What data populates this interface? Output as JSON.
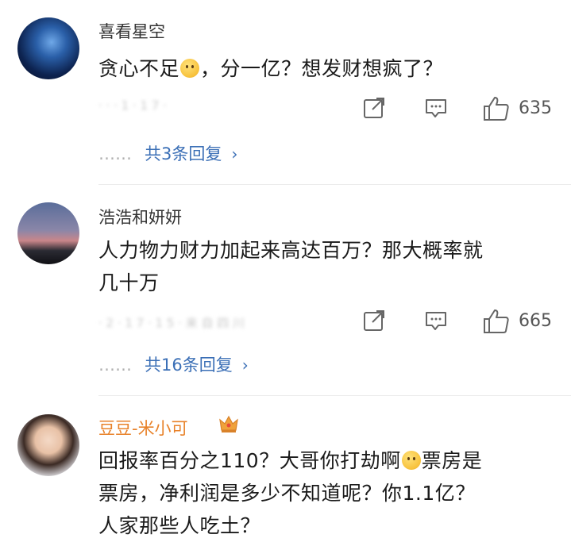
{
  "comments": [
    {
      "username": "喜看星空",
      "text_before_emoji": "贪心不足",
      "text_after_emoji": "，分一亿？想发财想疯了？",
      "meta": "· · · 1 · 1 7 ·",
      "likes": "635",
      "replies_prefix": "……",
      "replies_link": "共3条回复",
      "chevron": "›"
    },
    {
      "username": "浩浩和妍妍",
      "line1": "人力物力财力加起来高达百万？那大概率就",
      "line2": "几十万",
      "meta": "· 2 · 1 7 · 1 5 · 来 自 四 川",
      "likes": "665",
      "replies_prefix": "……",
      "replies_link": "共16条回复",
      "chevron": "›"
    },
    {
      "username": "豆豆-米小可",
      "line1_before_emoji": "回报率百分之110？大哥你打劫啊",
      "line1_after_emoji": "票房是",
      "line2": "票房，净利润是多少不知道呢？你1.1亿？",
      "line3": "人家那些人吃土？"
    }
  ],
  "icons": {
    "share": "share-icon",
    "comment": "comment-icon",
    "like": "thumbs-up-icon",
    "crown": "crown-badge-icon",
    "emoji1": "drooling-face-emoji-icon",
    "emoji2": "smile-face-emoji-icon"
  },
  "colors": {
    "link": "#3b6fb6",
    "vip_name": "#e8822a",
    "username": "#333333"
  }
}
